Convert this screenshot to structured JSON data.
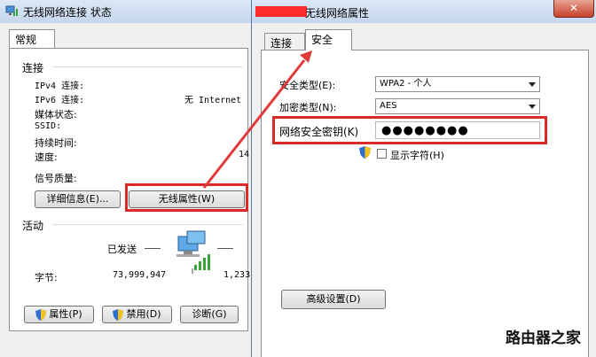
{
  "left_window": {
    "title": "无线网络连接 状态",
    "tab_general": "常规",
    "connection": {
      "heading": "连接",
      "ipv4_label": "IPv4 连接:",
      "ipv6_label": "IPv6 连接:",
      "ipv6_value": "无 Internet",
      "media_label": "媒体状态:",
      "ssid_label": "SSID:",
      "duration_label": "持续时间:",
      "speed_label": "速度:",
      "speed_value": "14",
      "signal_label": "信号质量:"
    },
    "details_button": "详细信息(E)...",
    "wireless_props_button": "无线属性(W)",
    "activity": {
      "heading": "活动",
      "sent_label": "已发送",
      "bytes_label": "字节:",
      "sent_value": "73,999,947",
      "received_value": "1,233"
    },
    "properties_button": "属性(P)",
    "disable_button": "禁用(D)",
    "diagnose_button": "诊断(G)"
  },
  "right_window": {
    "title": "无线网络属性",
    "close_glyph": "✕",
    "tab_connection": "连接",
    "tab_security": "安全",
    "security_type_label": "安全类型(E):",
    "security_type_value": "WPA2 - 个人",
    "encryption_label": "加密类型(N):",
    "encryption_value": "AES",
    "key_label": "网络安全密钥(K)",
    "key_value": "●●●●●●●●",
    "show_chars_label": "显示字符(H)",
    "advanced_button": "高级设置(D)"
  },
  "watermark": "路由器之家",
  "colors": {
    "highlight": "#d92a2a",
    "arrow": "#e03a3a",
    "redaction": "#ff2a2a"
  }
}
